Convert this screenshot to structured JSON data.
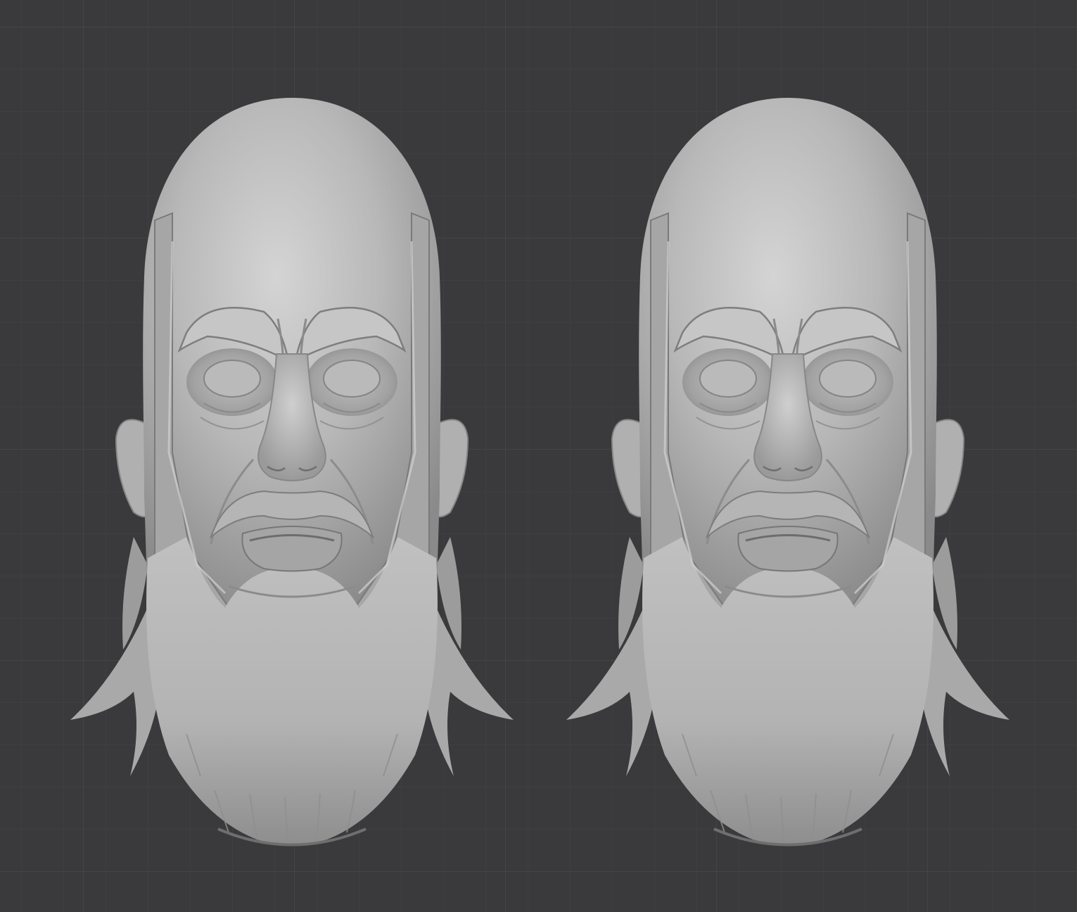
{
  "viewport": {
    "background_color": "#3a3a3c",
    "grid_minor_color": "#434345",
    "grid_major_color": "#4a4a4d",
    "mesh_color": "#b9b9b9",
    "mesh_shadow_color": "#6c6c6c",
    "mesh_highlight_color": "#dedede"
  },
  "objects": [
    {
      "name": "sculpt-head-left",
      "shading": "matcap-clay"
    },
    {
      "name": "sculpt-head-right",
      "shading": "matcap-clay-smooth"
    }
  ]
}
